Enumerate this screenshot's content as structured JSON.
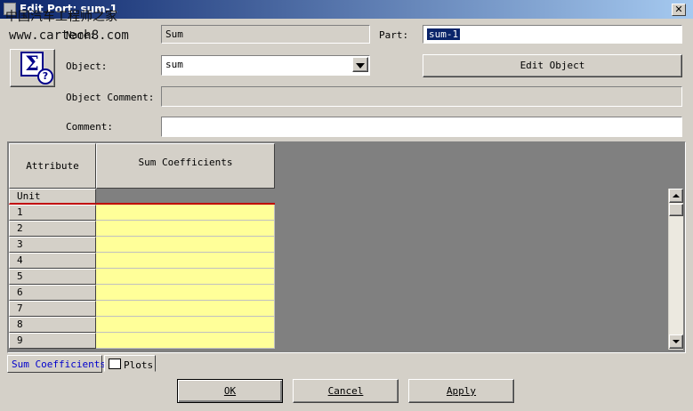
{
  "window": {
    "title": "Edit Port: sum-1",
    "close_glyph": "✕"
  },
  "watermark": {
    "line1": "中国汽车工程师之家",
    "line2": "www.cartech8.com"
  },
  "form": {
    "name_label": "Name:",
    "name_value": "Sum",
    "part_label": "Part:",
    "part_value": "sum-1",
    "object_label": "Object:",
    "object_value": "sum",
    "edit_object_label": "Edit Object",
    "object_comment_label": "Object Comment:",
    "object_comment_value": "",
    "comment_label": "Comment:",
    "comment_value": ""
  },
  "icons": {
    "sigma_glyph": "Σ",
    "help_glyph": "?"
  },
  "table": {
    "corner_header": "Attribute",
    "column_header": "Sum Coefficients",
    "unit_label": "Unit",
    "rows": [
      "1",
      "2",
      "3",
      "4",
      "5",
      "6",
      "7",
      "8",
      "9"
    ]
  },
  "tabs": [
    {
      "label": "Sum Coefficients",
      "active": true
    },
    {
      "label": "Plots",
      "active": false
    }
  ],
  "buttons": {
    "ok": "OK",
    "cancel": "Cancel",
    "apply": "Apply"
  },
  "colors": {
    "cell_fill": "#ffff99",
    "unit_cell_fill": "#808080",
    "title_bar": "#0a246a",
    "active_tab_text": "#0000cc"
  }
}
